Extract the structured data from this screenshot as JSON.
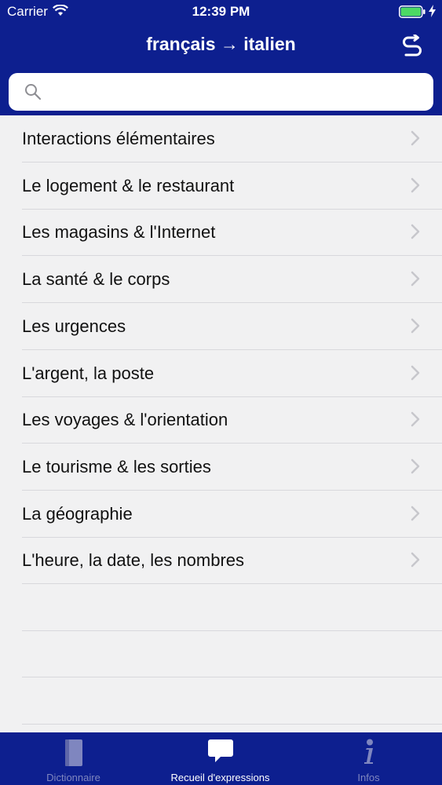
{
  "status_bar": {
    "carrier": "Carrier",
    "time": "12:39 PM",
    "battery_percent": 100
  },
  "header": {
    "title": "français → italien",
    "swap_icon": "swap-icon"
  },
  "search": {
    "placeholder": "",
    "value": ""
  },
  "categories": [
    "Interactions élémentaires",
    "Le logement & le restaurant",
    "Les magasins & l'Internet",
    "La santé & le corps",
    "Les urgences",
    "L'argent, la poste",
    "Les voyages & l'orientation",
    "Le tourisme & les sorties",
    "La géographie",
    "L'heure, la date, les nombres"
  ],
  "tabbar": {
    "tabs": [
      {
        "label": "Dictionnaire",
        "icon": "book-icon",
        "active": false
      },
      {
        "label": "Recueil d'expressions",
        "icon": "speech-bubble-icon",
        "active": true
      },
      {
        "label": "Infos",
        "icon": "info-icon",
        "active": false
      }
    ]
  },
  "colors": {
    "brand_blue": "#0d1f8f",
    "list_background": "#f1f1f2",
    "inactive_tab": "#7f86bf"
  }
}
